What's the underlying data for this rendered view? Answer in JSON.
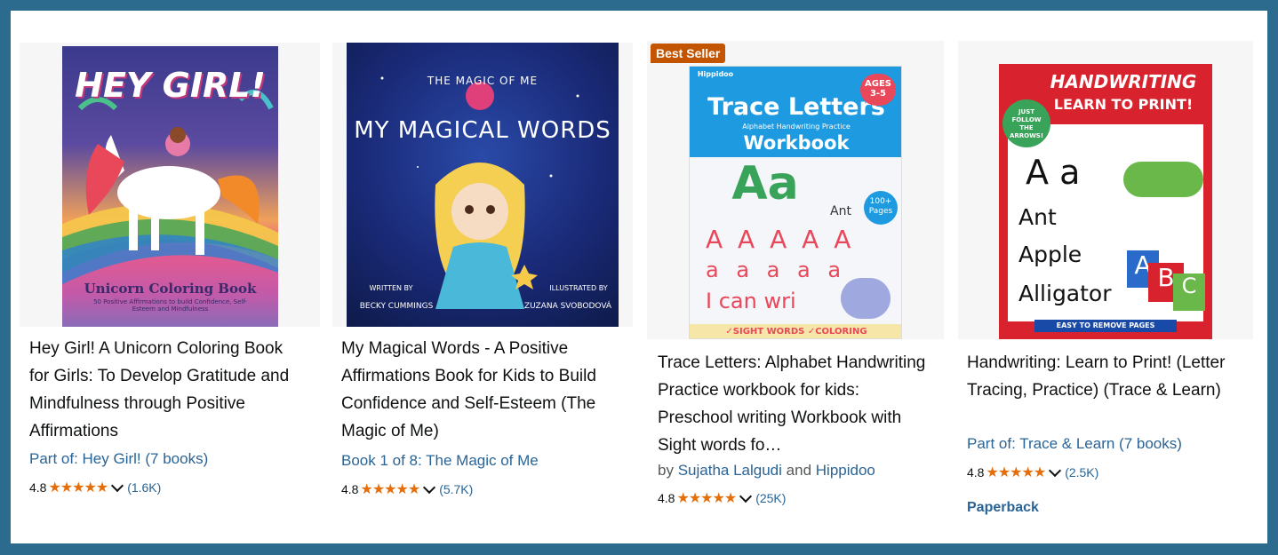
{
  "products": [
    {
      "title": "Hey Girl! A Unicorn Coloring Book for Girls: To Develop Gratitude and Mindfulness through Positive Affirmations",
      "series_link": "Part of: Hey Girl! (7 books)",
      "rating": "4.8",
      "stars": "★★★★★",
      "review_count": "(1.6K)",
      "cover": {
        "headline": "HEY GIRL!",
        "subtitle": "Unicorn Coloring Book",
        "tagline": "50 Positive Affirmations to build Confidence, Self-Esteem and Mindfulness"
      }
    },
    {
      "title": "My Magical Words - A Positive Affirmations Book for Kids to Build Confidence and Self-Esteem (The Magic of Me)",
      "series_link": "Book 1 of 8: The Magic of Me",
      "rating": "4.8",
      "stars": "★★★★★",
      "review_count": "(5.7K)",
      "cover": {
        "series": "THE MAGIC OF ME",
        "headline": "MY MAGICAL WORDS",
        "written_by": "WRITTEN BY",
        "author": "BECKY CUMMINGS",
        "illustrated_by": "ILLUSTRATED BY",
        "illustrator": "ZUZANA SVOBODOVÁ"
      }
    },
    {
      "badge": "Best Seller",
      "title": "Trace Letters: Alphabet Handwriting Practice workbook for kids: Preschool writing Workbook with Sight words fo…",
      "by_prefix": "by",
      "author1": "Sujatha Lalgudi",
      "and": "and",
      "author2": "Hippidoo",
      "rating": "4.8",
      "stars": "★★★★★",
      "review_count": "(25K)",
      "cover": {
        "brand": "Hippidoo",
        "headline": "Trace Letters",
        "sub": "Alphabet Handwriting Practice",
        "workbook": "Workbook",
        "ages": "AGES 3-5",
        "pages": "100+ Pages",
        "big_letters": "Aa",
        "ant": "Ant",
        "row1": "A A A A A",
        "row2": "a a a a a",
        "row3": "I can wri",
        "footer": "✓SIGHT WORDS  ✓COLORING"
      }
    },
    {
      "title": "Handwriting: Learn to Print! (Letter Tracing, Practice) (Trace & Learn)",
      "series_link": "Part of: Trace & Learn (7 books)",
      "rating": "4.8",
      "stars": "★★★★★",
      "review_count": "(2.5K)",
      "format": "Paperback",
      "cover": {
        "headline": "HANDWRITING",
        "sub": "LEARN TO PRINT!",
        "badge": "JUST FOLLOW THE ARROWS!",
        "letters": "A a",
        "w1": "Ant",
        "w2": "Apple",
        "w3": "Alligator",
        "footer": "EASY TO REMOVE PAGES",
        "blocks": [
          "A",
          "B",
          "C"
        ]
      }
    }
  ],
  "colors": {
    "frame": "#2c6b8e",
    "link": "#2a6496",
    "star": "#e56e0a",
    "badge": "#c45500"
  }
}
